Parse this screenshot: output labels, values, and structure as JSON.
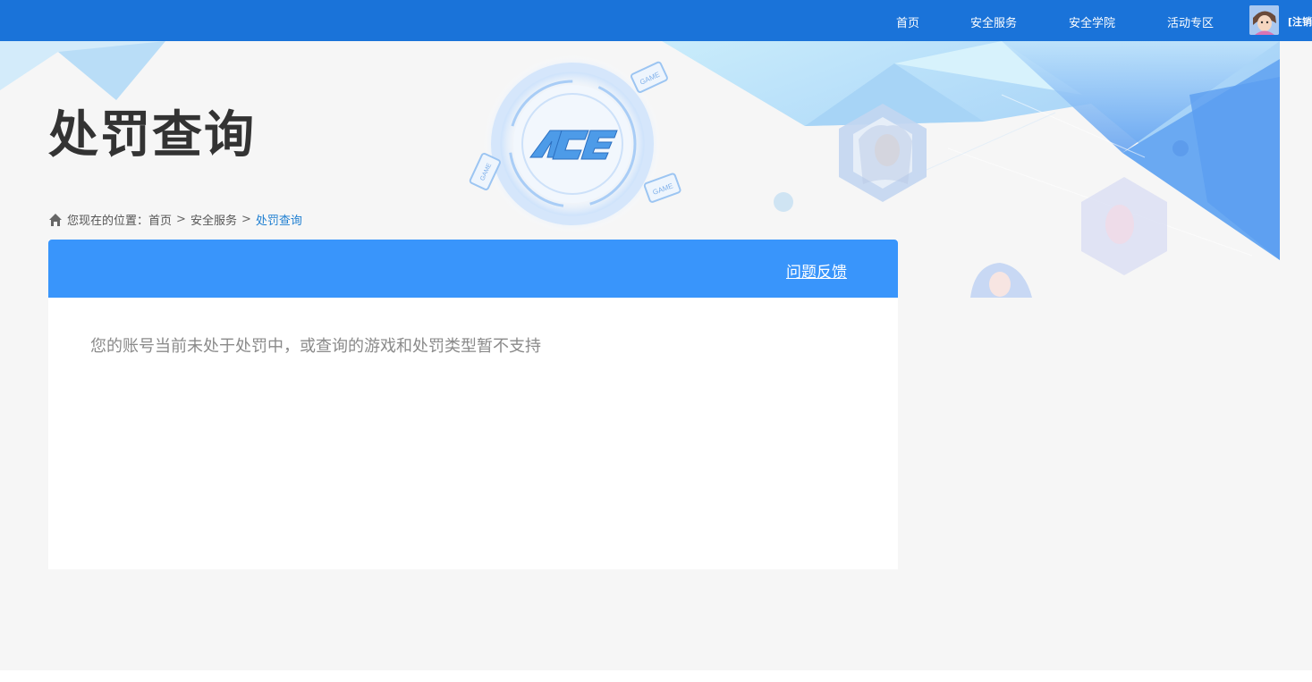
{
  "nav": {
    "items": [
      "首页",
      "安全服务",
      "安全学院",
      "活动专区"
    ],
    "logout": "[注销]"
  },
  "page": {
    "title": "处罚查询",
    "ace_logo": "ACE"
  },
  "breadcrumb": {
    "prefix": "您现在的位置：",
    "items": [
      "首页",
      "安全服务"
    ],
    "separator": ">",
    "current": "处罚查询"
  },
  "panel": {
    "feedback_link": "问题反馈",
    "message": "您的账号当前未处于处罚中，或查询的游戏和处罚类型暂不支持"
  },
  "colors": {
    "topbar": "#1a73d9",
    "panel_header": "#3995fb",
    "breadcrumb_current": "#1f7fd1"
  },
  "icons": {
    "home": "home-icon",
    "avatar": "avatar"
  }
}
